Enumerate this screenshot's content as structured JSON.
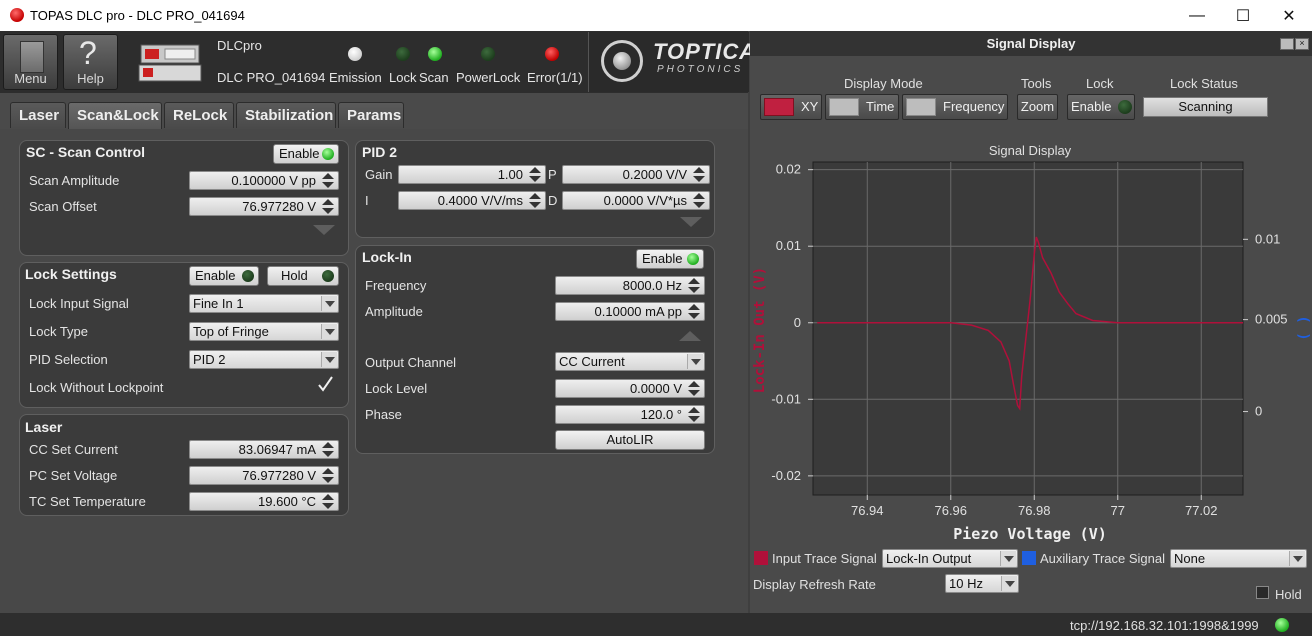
{
  "window": {
    "title": "TOPAS DLC pro - DLC PRO_041694",
    "minimize": "—",
    "maximize": "☐",
    "close": "✕"
  },
  "header": {
    "menu_label": "Menu",
    "help_label": "Help",
    "device_name": "DLCpro",
    "device_id": "DLC PRO_041694",
    "indicators": [
      {
        "label": "Emission",
        "state": "white"
      },
      {
        "label": "Lock",
        "state": "dark-green"
      },
      {
        "label": "Scan",
        "state": "green"
      },
      {
        "label": "PowerLock",
        "state": "dark-green"
      },
      {
        "label": "Error(1/1)",
        "state": "red"
      }
    ],
    "logo_text": "TOPTICA",
    "logo_sub": "PHOTONICS"
  },
  "tabs": [
    {
      "label": "Laser",
      "active": false
    },
    {
      "label": "Scan&Lock",
      "active": true
    },
    {
      "label": "ReLock",
      "active": false
    },
    {
      "label": "Stabilization",
      "active": false
    },
    {
      "label": "Params",
      "active": false
    }
  ],
  "scan_control": {
    "title": "SC - Scan Control",
    "enable_label": "Enable",
    "amplitude_label": "Scan Amplitude",
    "amplitude_value": "0.100000 V pp",
    "offset_label": "Scan Offset",
    "offset_value": "76.977280 V"
  },
  "pid2": {
    "title": "PID 2",
    "gain_label": "Gain",
    "gain_value": "1.00",
    "p_label": "P",
    "p_value": "0.2000 V/V",
    "i_label": "I",
    "i_value": "0.4000 V/V/ms",
    "d_label": "D",
    "d_value": "0.0000 V/V*µs"
  },
  "lock_settings": {
    "title": "Lock Settings",
    "enable_label": "Enable",
    "hold_label": "Hold",
    "input_label": "Lock Input Signal",
    "input_value": "Fine In 1",
    "type_label": "Lock Type",
    "type_value": "Top of Fringe",
    "pid_label": "PID Selection",
    "pid_value": "PID 2",
    "without_label": "Lock Without Lockpoint",
    "without_checked": true
  },
  "laser": {
    "title": "Laser",
    "cc_label": "CC Set Current",
    "cc_value": "83.06947 mA",
    "pc_label": "PC Set Voltage",
    "pc_value": "76.977280 V",
    "tc_label": "TC Set Temperature",
    "tc_value": "19.600 °C"
  },
  "lockin": {
    "title": "Lock-In",
    "enable_label": "Enable",
    "freq_label": "Frequency",
    "freq_value": "8000.0 Hz",
    "amp_label": "Amplitude",
    "amp_value": "0.10000 mA pp",
    "outch_label": "Output Channel",
    "outch_value": "CC Current",
    "level_label": "Lock Level",
    "level_value": "0.0000 V",
    "phase_label": "Phase",
    "phase_value": "120.0 °",
    "autolir_label": "AutoLIR"
  },
  "signal_display": {
    "title": "Signal Display",
    "display_mode_label": "Display Mode",
    "tools_label": "Tools",
    "lock_label": "Lock",
    "lock_status_label": "Lock Status",
    "xy_label": "XY",
    "time_label": "Time",
    "frequency_label": "Frequency",
    "zoom_label": "Zoom",
    "lock_enable_label": "Enable",
    "lock_status_value": "Scanning",
    "input_trace_label": "Input Trace Signal",
    "input_trace_value": "Lock-In Output",
    "aux_trace_label": "Auxiliary Trace Signal",
    "aux_trace_value": "None",
    "refresh_label": "Display Refresh Rate",
    "refresh_value": "10 Hz",
    "hold_label": "Hold",
    "colors": {
      "input": "#b0103a",
      "aux": "#1f5fe0"
    }
  },
  "status": {
    "connection": "tcp://192.168.32.101:1998&1999"
  },
  "chart_data": {
    "type": "line",
    "title": "Signal Display",
    "xlabel": "Piezo Voltage (V)",
    "ylabel": "Lock-In Out (V)",
    "ylabel_right": "( )",
    "xlim": [
      76.927,
      77.03
    ],
    "ylim": [
      -0.0225,
      0.021
    ],
    "xticks": [
      "76.94",
      "76.96",
      "76.98",
      "77",
      "77.02"
    ],
    "xtick_values": [
      76.94,
      76.96,
      76.98,
      77.0,
      77.02
    ],
    "yticks": [
      "0.02",
      "0.01",
      "0",
      "-0.01",
      "-0.02"
    ],
    "ytick_values": [
      0.02,
      0.01,
      0,
      -0.01,
      -0.02
    ],
    "yticks_right": [
      "0.01",
      "0.005",
      "0"
    ],
    "ytick_right_values": [
      0.0109,
      0.00041,
      -0.0116
    ],
    "grid": true,
    "series": [
      {
        "color": "#b0103a",
        "x": [
          76.928,
          76.96,
          76.965,
          76.969,
          76.972,
          76.974,
          76.975,
          76.976,
          76.9765,
          76.977,
          76.978,
          76.979,
          76.98,
          76.9805,
          76.981,
          76.982,
          76.984,
          76.986,
          76.988,
          76.99,
          76.994,
          77.0,
          77.03
        ],
        "y": [
          0,
          0,
          -0.0003,
          -0.001,
          -0.0025,
          -0.005,
          -0.008,
          -0.0108,
          -0.0112,
          -0.007,
          -0.002,
          0.003,
          0.009,
          0.0112,
          0.0105,
          0.0085,
          0.0065,
          0.004,
          0.0025,
          0.0012,
          0.0003,
          0,
          0
        ]
      }
    ]
  }
}
